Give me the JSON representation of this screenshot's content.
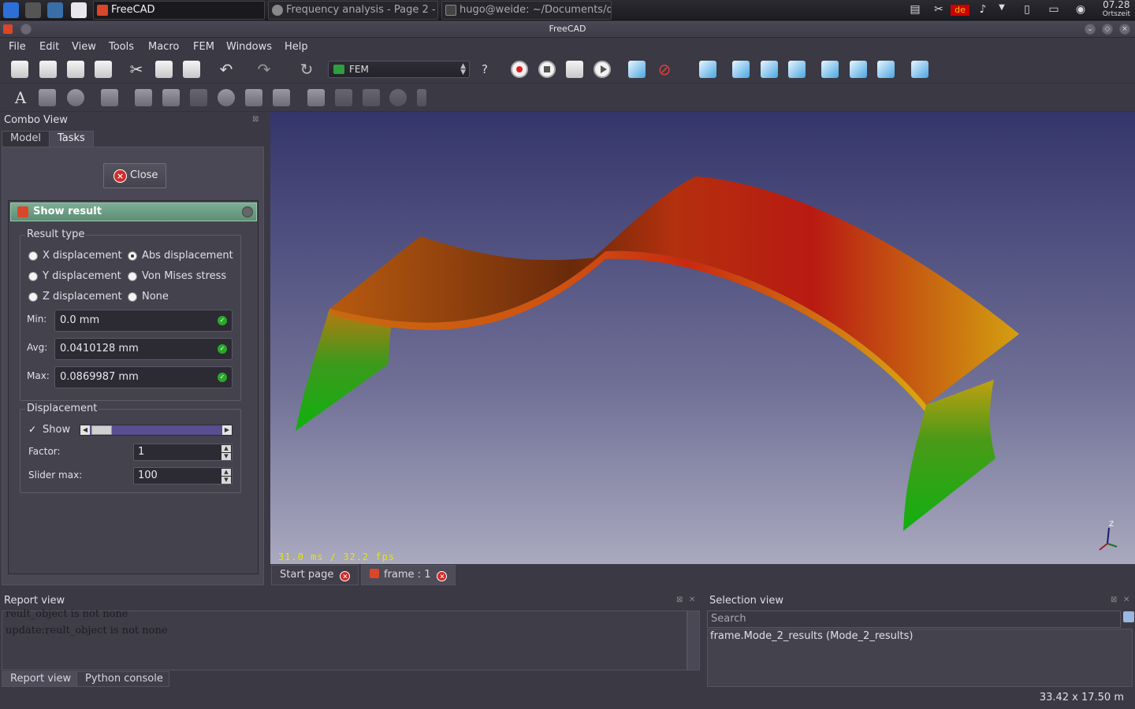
{
  "taskbar": {
    "tasks": [
      {
        "label": "FreeCAD",
        "active": true
      },
      {
        "label": "Frequency analysis - Page 2 -",
        "active": false
      },
      {
        "label": "hugo@weide: ~/Documents/d",
        "active": false
      }
    ],
    "keyboard_layout": "de",
    "clock_time": "07.28",
    "clock_zone": "Ortszeit"
  },
  "window": {
    "title": "FreeCAD"
  },
  "menu": [
    "File",
    "Edit",
    "View",
    "Tools",
    "Macro",
    "FEM",
    "Windows",
    "Help"
  ],
  "workbench": {
    "selected": "FEM"
  },
  "combo_view": {
    "title": "Combo View",
    "tabs": [
      "Model",
      "Tasks"
    ],
    "active_tab": "Tasks",
    "close_label": "Close",
    "task_title": "Show result",
    "result_type": {
      "title": "Result type",
      "options": [
        "X displacement",
        "Abs displacement",
        "Y displacement",
        "Von Mises stress",
        "Z displacement",
        "None"
      ],
      "selected": "Abs displacement"
    },
    "min_label": "Min:",
    "min_value": "0.0 mm",
    "avg_label": "Avg:",
    "avg_value": "0.0410128 mm",
    "max_label": "Max:",
    "max_value": "0.0869987 mm",
    "displacement": {
      "title": "Displacement",
      "show_label": "Show",
      "show_checked": true,
      "factor_label": "Factor:",
      "factor_value": "1",
      "slider_max_label": "Slider max:",
      "slider_max_value": "100"
    }
  },
  "view3d": {
    "fps": "31.0 ms / 32.2 fps",
    "tabs": [
      "Start page",
      "frame : 1"
    ],
    "active_tab": "frame : 1",
    "axis_label": "Z"
  },
  "report_view": {
    "title": "Report view",
    "lines": [
      "reult_object is not none",
      "update:reult_object is not none"
    ],
    "tabs": [
      "Report view",
      "Python console"
    ],
    "active_tab": "Report view"
  },
  "selection_view": {
    "title": "Selection view",
    "search_placeholder": "Search",
    "items": [
      "frame.Mode_2_results (Mode_2_results)"
    ]
  },
  "status": {
    "dimensions": "33.42 x 17.50 m"
  }
}
